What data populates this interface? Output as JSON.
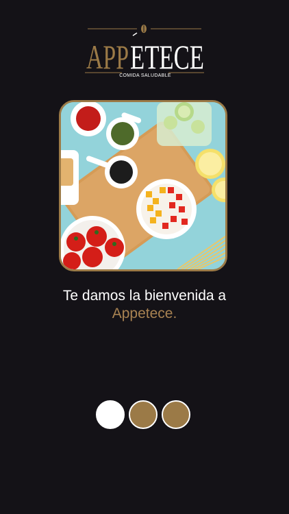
{
  "brand": {
    "name_prefix": "APP",
    "name_suffix": "ETECE",
    "tagline": "COMIDA SALUDABLE",
    "colors": {
      "gold": "#9b7a47",
      "text_gold": "#a98352",
      "background": "#141217",
      "white": "#ffffff"
    }
  },
  "hero_image": {
    "icon": "food-flatlay-image"
  },
  "welcome": {
    "line1": "Te damos la bienvenida a",
    "line2": "Appetece."
  },
  "pager": {
    "total": 3,
    "active_index": 0
  }
}
